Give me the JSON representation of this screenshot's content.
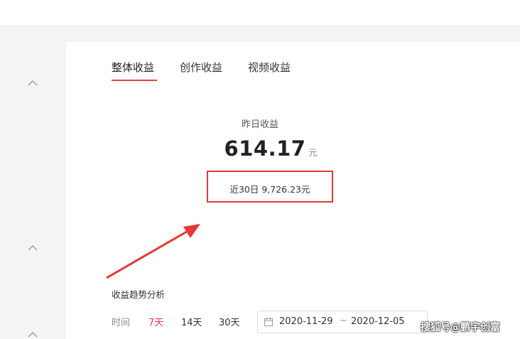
{
  "tabs": [
    {
      "label": "整体收益",
      "active": true
    },
    {
      "label": "创作收益",
      "active": false
    },
    {
      "label": "视频收益",
      "active": false
    }
  ],
  "summary": {
    "yesterday_label": "昨日收益",
    "yesterday_amount": "614.17",
    "unit": "元",
    "recent_30": "近30日 9,726.23元"
  },
  "trend": {
    "title": "收益趋势分析",
    "time_label": "时间",
    "ranges": [
      {
        "label": "7天",
        "active": true
      },
      {
        "label": "14天",
        "active": false
      },
      {
        "label": "30天",
        "active": false
      }
    ],
    "date_start": "2020-11-29",
    "date_sep": "~",
    "date_end": "2020-12-05"
  },
  "sidebar": {
    "chevrons": [
      "chevron-up-icon",
      "chevron-up-icon",
      "chevron-up-icon"
    ]
  },
  "watermark": "搜狐号@鹏宇创富",
  "colors": {
    "accent": "#e8413c",
    "highlight_box": "#e53935",
    "sidebar_bg": "#f4f4f4"
  }
}
